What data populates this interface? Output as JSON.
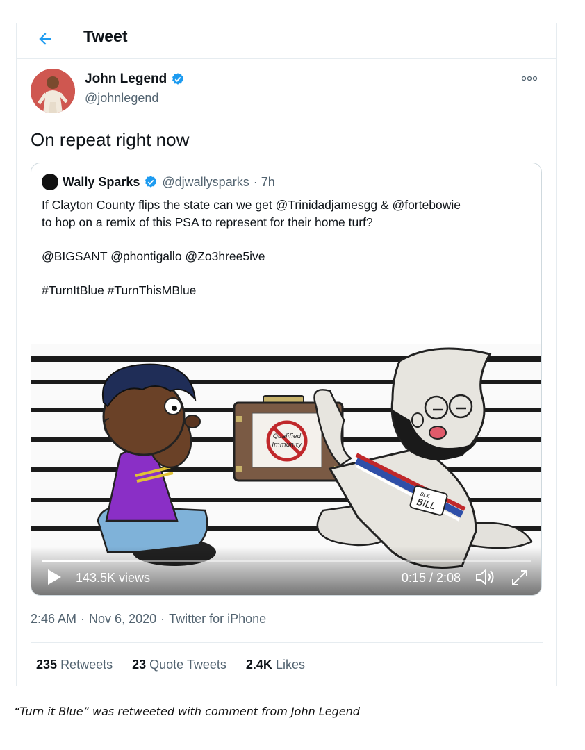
{
  "header": {
    "title": "Tweet"
  },
  "author": {
    "name": "John Legend",
    "handle": "@johnlegend"
  },
  "tweet": {
    "text": "On repeat right now"
  },
  "quote": {
    "name": "Wally Sparks",
    "handle": "@djwallysparks",
    "age": "· 7h",
    "lines": [
      "If Clayton County flips the state can we get @Trinidadjamesgg & @fortebowie",
      "to hop on a remix of this PSA to represent for their home turf?",
      "@BIGSANT @phontigallo @Zo3hree5ive",
      "#TurnItBlue #TurnThisMBlue"
    ],
    "video": {
      "views": "143.5K views",
      "time": "0:15 / 2:08",
      "progress": 0.12,
      "briefcase_label_1": "Qualified",
      "briefcase_label_2": "Immunity",
      "badge_line_1": "BLK",
      "badge_line_2": "BILL"
    }
  },
  "meta": {
    "time": "2:46 AM",
    "date": "Nov 6, 2020",
    "source": "Twitter for iPhone"
  },
  "stats": {
    "retweets_count": "235",
    "retweets_label": "Retweets",
    "quotes_count": "23",
    "quotes_label": "Quote Tweets",
    "likes_count": "2.4K",
    "likes_label": "Likes"
  },
  "caption": "“Turn it Blue” was retweeted with comment from John Legend",
  "colors": {
    "accent": "#1d9bf0",
    "verified": "#1d9bf0",
    "muted": "#536471"
  },
  "icons": [
    "back-arrow-icon",
    "verified-badge-icon",
    "more-options-icon",
    "play-icon",
    "volume-icon",
    "fullscreen-icon"
  ]
}
